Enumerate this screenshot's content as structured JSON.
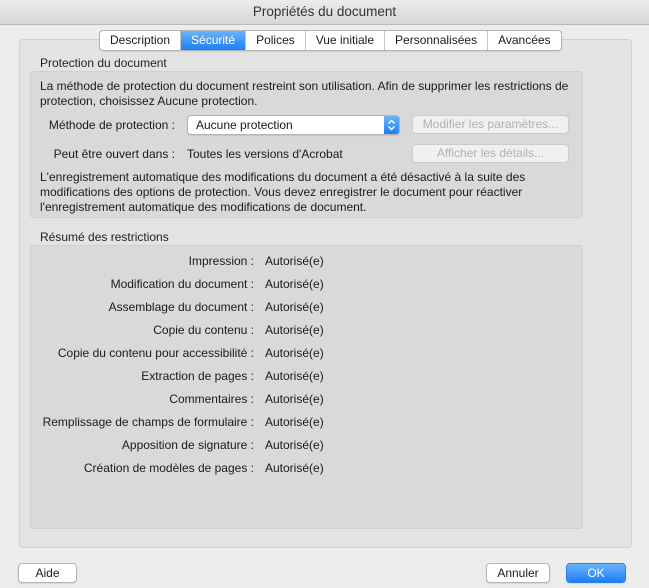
{
  "window": {
    "title": "Propriétés du document"
  },
  "tabs": [
    {
      "label": "Description"
    },
    {
      "label": "Sécurité",
      "active": true
    },
    {
      "label": "Polices"
    },
    {
      "label": "Vue initiale"
    },
    {
      "label": "Personnalisées"
    },
    {
      "label": "Avancées"
    }
  ],
  "protection": {
    "section_title": "Protection du document",
    "intro_line1": "La méthode de protection du document restreint son utilisation. Afin de supprimer les restrictions de",
    "intro_line2": "protection, choisissez Aucune protection.",
    "method_label": "Méthode de protection :",
    "method_value": "Aucune protection",
    "modify_button": "Modifier les paramètres...",
    "open_label": "Peut être ouvert dans :",
    "open_value": "Toutes les versions d'Acrobat",
    "details_button": "Afficher les détails...",
    "autosave_line1": "L'enregistrement automatique des modifications du document a été désactivé à la suite des",
    "autosave_line2": "modifications des options de protection. Vous devez enregistrer le document pour réactiver",
    "autosave_line3": "l'enregistrement automatique des modifications de document."
  },
  "restrictions": {
    "section_title": "Résumé des restrictions",
    "items": [
      {
        "label": "Impression :",
        "value": "Autorisé(e)"
      },
      {
        "label": "Modification du document :",
        "value": "Autorisé(e)"
      },
      {
        "label": "Assemblage du document :",
        "value": "Autorisé(e)"
      },
      {
        "label": "Copie du contenu :",
        "value": "Autorisé(e)"
      },
      {
        "label": "Copie du contenu pour accessibilité :",
        "value": "Autorisé(e)"
      },
      {
        "label": "Extraction de pages :",
        "value": "Autorisé(e)"
      },
      {
        "label": "Commentaires :",
        "value": "Autorisé(e)"
      },
      {
        "label": "Remplissage de champs de formulaire :",
        "value": "Autorisé(e)"
      },
      {
        "label": "Apposition de signature :",
        "value": "Autorisé(e)"
      },
      {
        "label": "Création de modèles de pages :",
        "value": "Autorisé(e)"
      }
    ]
  },
  "footer": {
    "help": "Aide",
    "cancel": "Annuler",
    "ok": "OK"
  },
  "colors": {
    "accent": "#1b7ff5"
  }
}
